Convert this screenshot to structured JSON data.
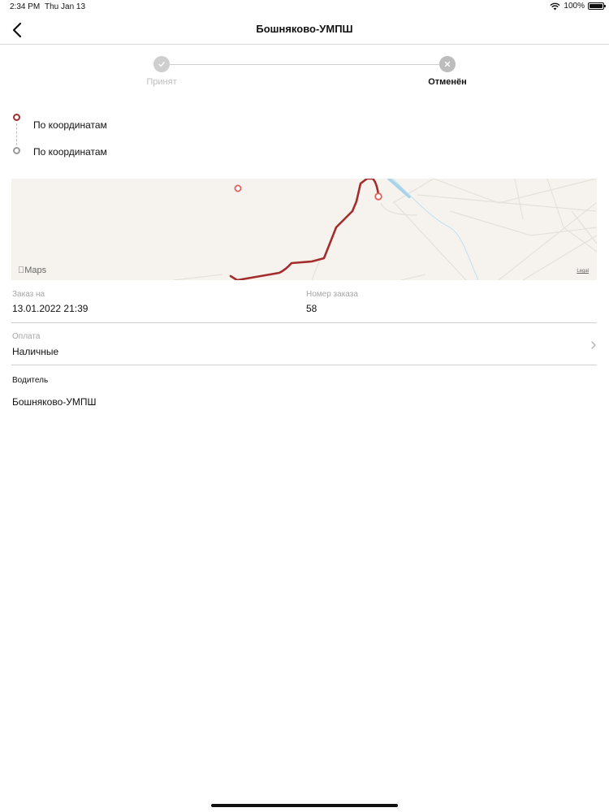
{
  "status_bar": {
    "time": "2:34 PM",
    "date": "Thu Jan 13",
    "battery": "100%"
  },
  "nav": {
    "title": "Бошняково-УМПШ"
  },
  "progress": {
    "steps": [
      {
        "label": "Принят",
        "state": "done"
      },
      {
        "label": "Отменён",
        "state": "current"
      }
    ]
  },
  "route": {
    "from": "По координатам",
    "to": "По координатам"
  },
  "map": {
    "logo": "Maps",
    "legal": "Legal",
    "route_color": "#a32c2c"
  },
  "order": {
    "date_label": "Заказ на",
    "date_value": "13.01.2022 21:39",
    "number_label": "Номер заказа",
    "number_value": "58"
  },
  "payment": {
    "label": "Оплата",
    "value": "Наличные"
  },
  "driver": {
    "label": "Водитель",
    "value": "Бошняково-УМПШ"
  },
  "colors": {
    "accent": "#a32c2c",
    "divider": "#cfcfcf",
    "muted": "#a6a6a6"
  }
}
